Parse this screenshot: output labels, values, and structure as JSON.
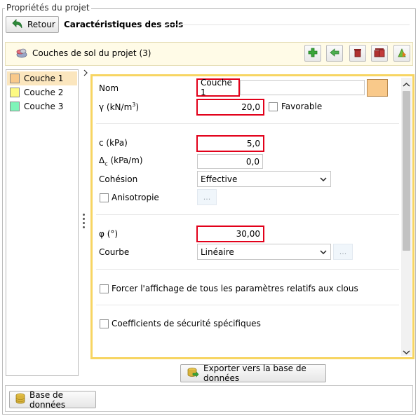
{
  "group_title": "Propriétés du projet",
  "header": {
    "back_label": "Retour",
    "title": "Caractéristiques des sols"
  },
  "layers_bar": {
    "title": "Couches de sol du projet (3)",
    "toolbar_icons": [
      "add-icon",
      "duplicate-icon",
      "delete-icon",
      "delete-all-icon",
      "import-icon"
    ]
  },
  "layers": [
    {
      "name": "Couche 1",
      "color": "#f9c98a",
      "selected": true
    },
    {
      "name": "Couche 2",
      "color": "#fdfa83",
      "selected": false
    },
    {
      "name": "Couche 3",
      "color": "#7ff5b9",
      "selected": false
    }
  ],
  "props": {
    "nom_label": "Nom",
    "nom_value": "Couche 1",
    "gamma_label": "γ (kN/m",
    "gamma_sup": "3",
    "gamma_close": ")",
    "gamma_value": "20,0",
    "favorable_label": "Favorable",
    "c_label": "c (kPa)",
    "c_value": "5,0",
    "delta_label_main": "Δ",
    "delta_label_sub": "c",
    "delta_label_rest": " (kPa/m)",
    "delta_value": "0,0",
    "cohesion_label": "Cohésion",
    "cohesion_value": "Effective",
    "anisotropie_label": "Anisotropie",
    "dots": "...",
    "phi_label": "φ (°)",
    "phi_value": "30,00",
    "courbe_label": "Courbe",
    "courbe_value": "Linéaire",
    "forcer_label": "Forcer l'affichage de tous les paramètres relatifs aux clous",
    "coeff_label": "Coefficients de sécurité spécifiques"
  },
  "export_label": "Exporter vers la base de données",
  "db_label": "Base de données",
  "colors": {
    "accent_border": "#f7d562",
    "highlight_red": "#e2001a",
    "selected_row": "#fbe6be",
    "layer_swatch_1": "#f9c98a"
  }
}
